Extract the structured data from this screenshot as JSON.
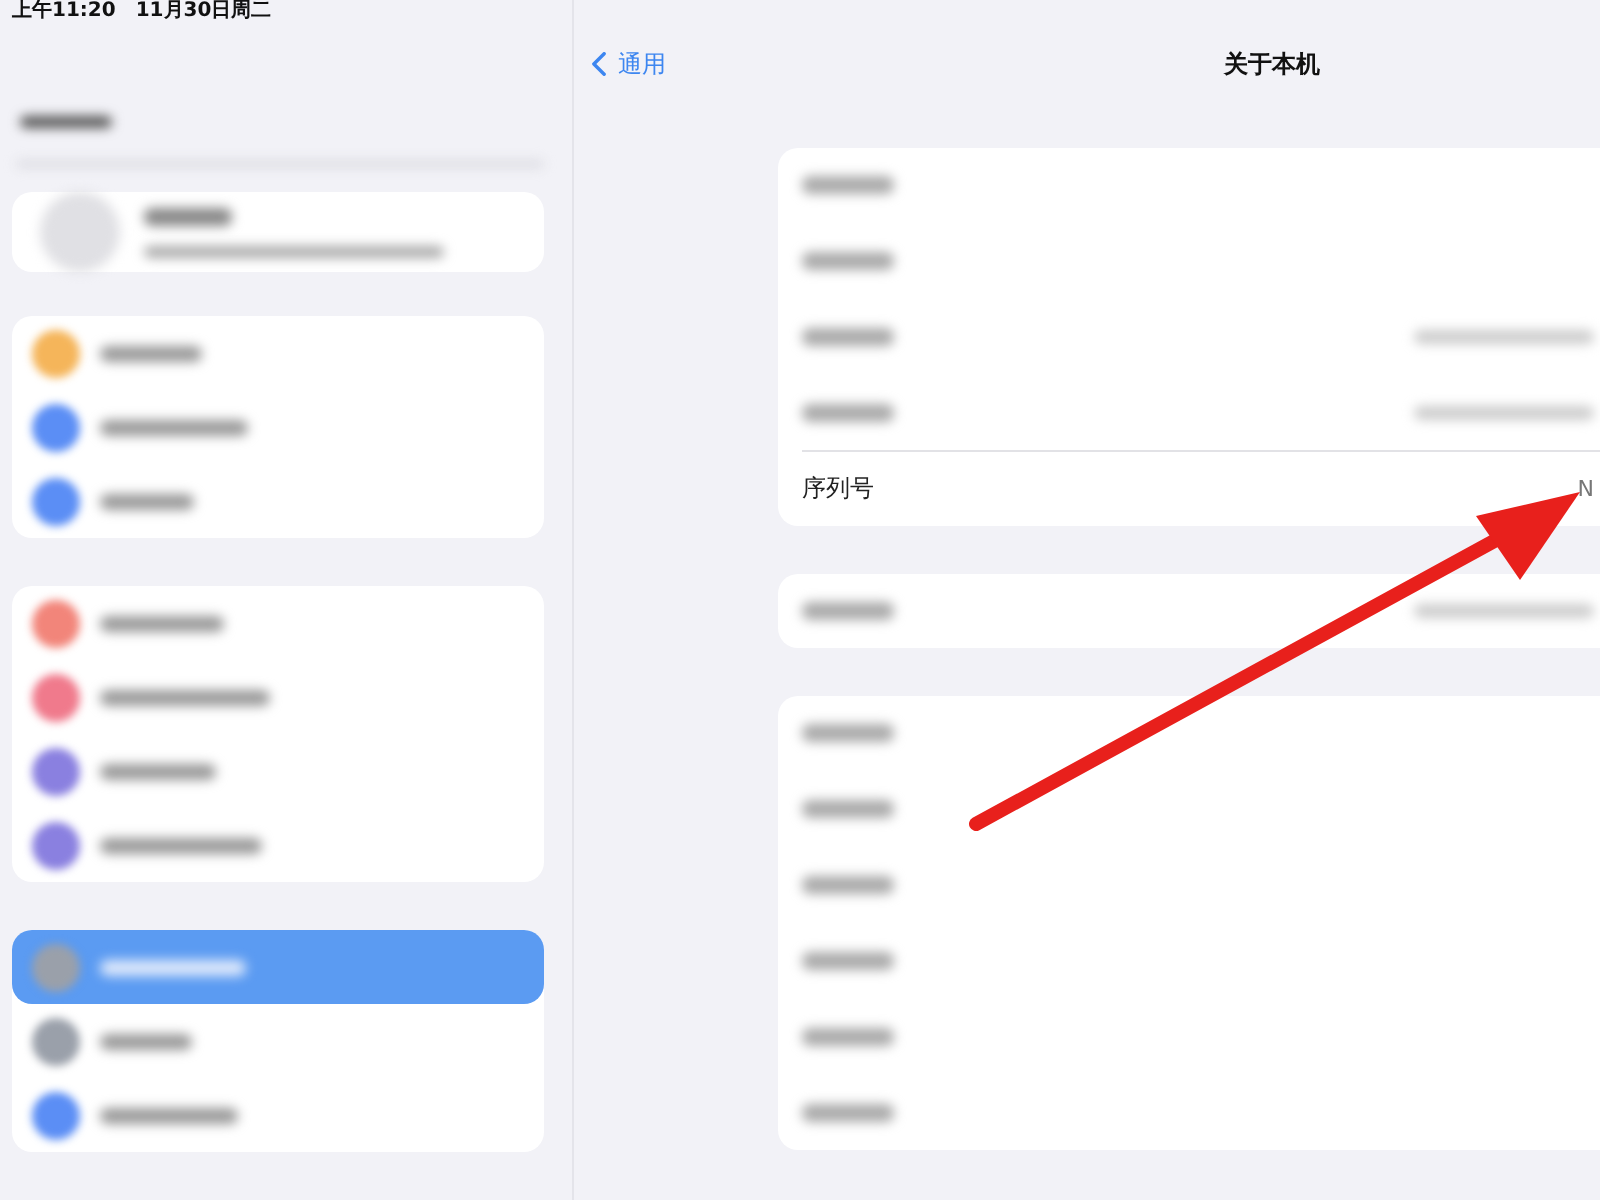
{
  "status_bar": {
    "time": "上午11:20",
    "date": "11月30日周二"
  },
  "sidebar": {
    "groups": [
      {
        "kind": "profile"
      },
      {
        "kind": "list",
        "items": [
          {
            "color": "#f5b55a",
            "selected": false
          },
          {
            "color": "#5b8ef5",
            "selected": false
          },
          {
            "color": "#5b8ef5",
            "selected": false
          }
        ]
      },
      {
        "kind": "list",
        "items": [
          {
            "color": "#f2857a",
            "selected": false
          },
          {
            "color": "#f07a8c",
            "selected": false
          },
          {
            "color": "#8a80e0",
            "selected": false
          },
          {
            "color": "#8a80e0",
            "selected": false
          }
        ]
      },
      {
        "kind": "list",
        "items": [
          {
            "color": "#9aa0aa",
            "selected": true
          },
          {
            "color": "#9aa0aa",
            "selected": false
          },
          {
            "color": "#5b8ef5",
            "selected": false
          }
        ]
      }
    ]
  },
  "nav": {
    "back": "通用",
    "title": "关于本机"
  },
  "cards": [
    {
      "rows": [
        {
          "kind": "blurred"
        },
        {
          "kind": "blurred"
        },
        {
          "kind": "blurred_with_value"
        },
        {
          "kind": "blurred_with_value"
        },
        {
          "kind": "field",
          "label": "序列号",
          "value": "N"
        }
      ]
    },
    {
      "rows": [
        {
          "kind": "blurred_with_value"
        }
      ]
    },
    {
      "rows": [
        {
          "kind": "blurred"
        },
        {
          "kind": "blurred"
        },
        {
          "kind": "blurred"
        },
        {
          "kind": "blurred"
        },
        {
          "kind": "blurred"
        },
        {
          "kind": "blurred"
        }
      ]
    }
  ],
  "overlay": {
    "kind": "arrow"
  }
}
